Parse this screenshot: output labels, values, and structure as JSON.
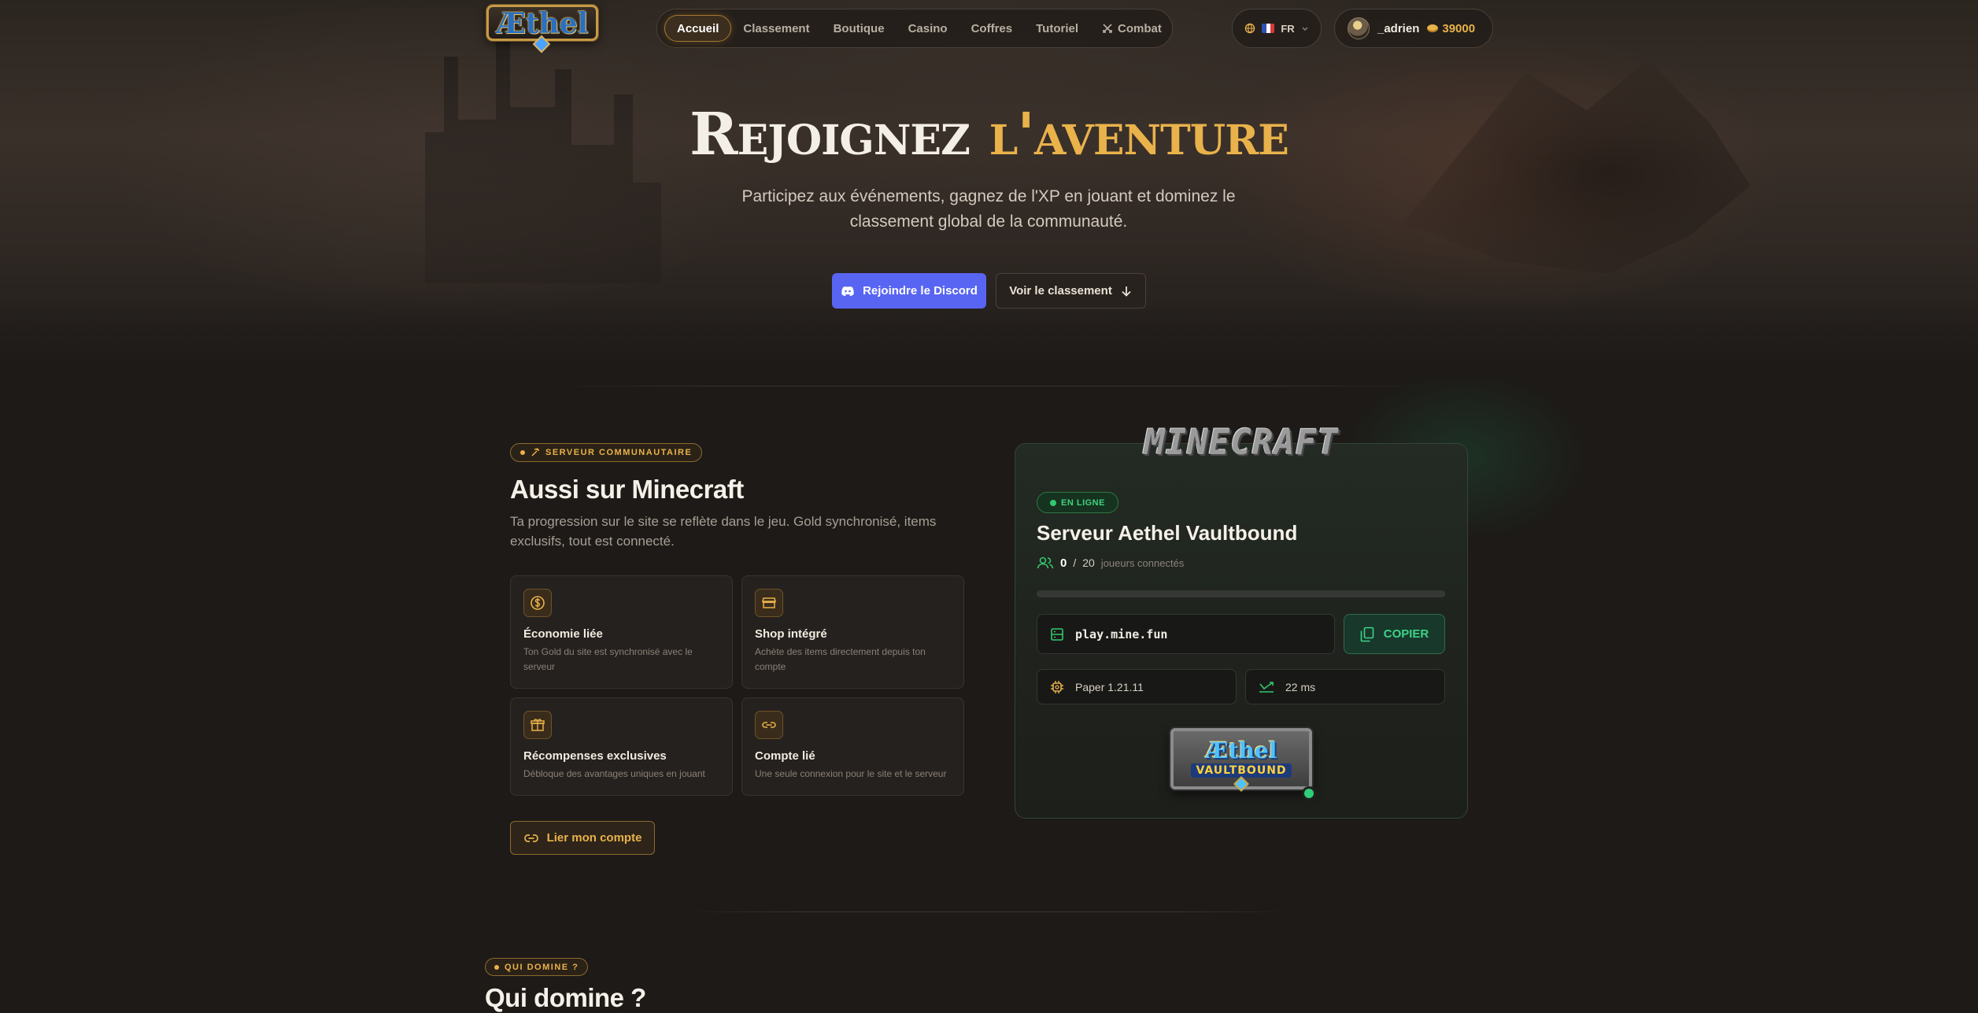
{
  "nav": {
    "logo_text": "Æthel",
    "items": [
      {
        "label": "Accueil",
        "active": true
      },
      {
        "label": "Classement"
      },
      {
        "label": "Boutique"
      },
      {
        "label": "Casino"
      },
      {
        "label": "Coffres"
      },
      {
        "label": "Tutoriel"
      },
      {
        "label": "Combat",
        "icon": "swords-icon"
      }
    ],
    "language": "FR",
    "user": {
      "name": "_adrien",
      "gold": "39000"
    }
  },
  "hero": {
    "title_part1": "Rejoignez",
    "title_part2": "l'aventure",
    "subtitle": "Participez aux événements, gagnez de l'XP en jouant et dominez le classement global de la communauté.",
    "discord_button": "Rejoindre le Discord",
    "ranking_button": "Voir le classement"
  },
  "minecraft": {
    "tag": "SERVEUR COMMUNAUTAIRE",
    "title": "Aussi sur Minecraft",
    "subtitle": "Ta progression sur le site se reflète dans le jeu. Gold synchronisé, items exclusifs, tout est connecté.",
    "features": [
      {
        "title": "Économie liée",
        "desc": "Ton Gold du site est synchronisé avec le serveur",
        "icon": "dollar-icon"
      },
      {
        "title": "Shop intégré",
        "desc": "Achète des items directement depuis ton compte",
        "icon": "store-icon"
      },
      {
        "title": "Récompenses exclusives",
        "desc": "Débloque des avantages uniques en jouant",
        "icon": "gift-icon"
      },
      {
        "title": "Compte lié",
        "desc": "Une seule connexion pour le site et le serveur",
        "icon": "link-icon"
      }
    ],
    "link_button": "Lier mon compte"
  },
  "server": {
    "game_logo": "MINECRAFT",
    "status": "EN LIGNE",
    "name": "Serveur Aethel Vaultbound",
    "players_online": "0",
    "players_sep": "/",
    "players_max": "20",
    "players_label": "joueurs connectés",
    "players_fill": 0,
    "address": "play.mine.fun",
    "copy_label": "COPIER",
    "version": "Paper 1.21.11",
    "ping": "22 ms",
    "banner_line1": "Æthel",
    "banner_line2": "VAULTBOUND"
  },
  "next_section": {
    "tag": "QUI DOMINE ?",
    "title": "Qui domine ?"
  },
  "colors": {
    "accent_gold": "#e9b24a",
    "discord": "#5865f2",
    "online_green": "#34c76e"
  }
}
